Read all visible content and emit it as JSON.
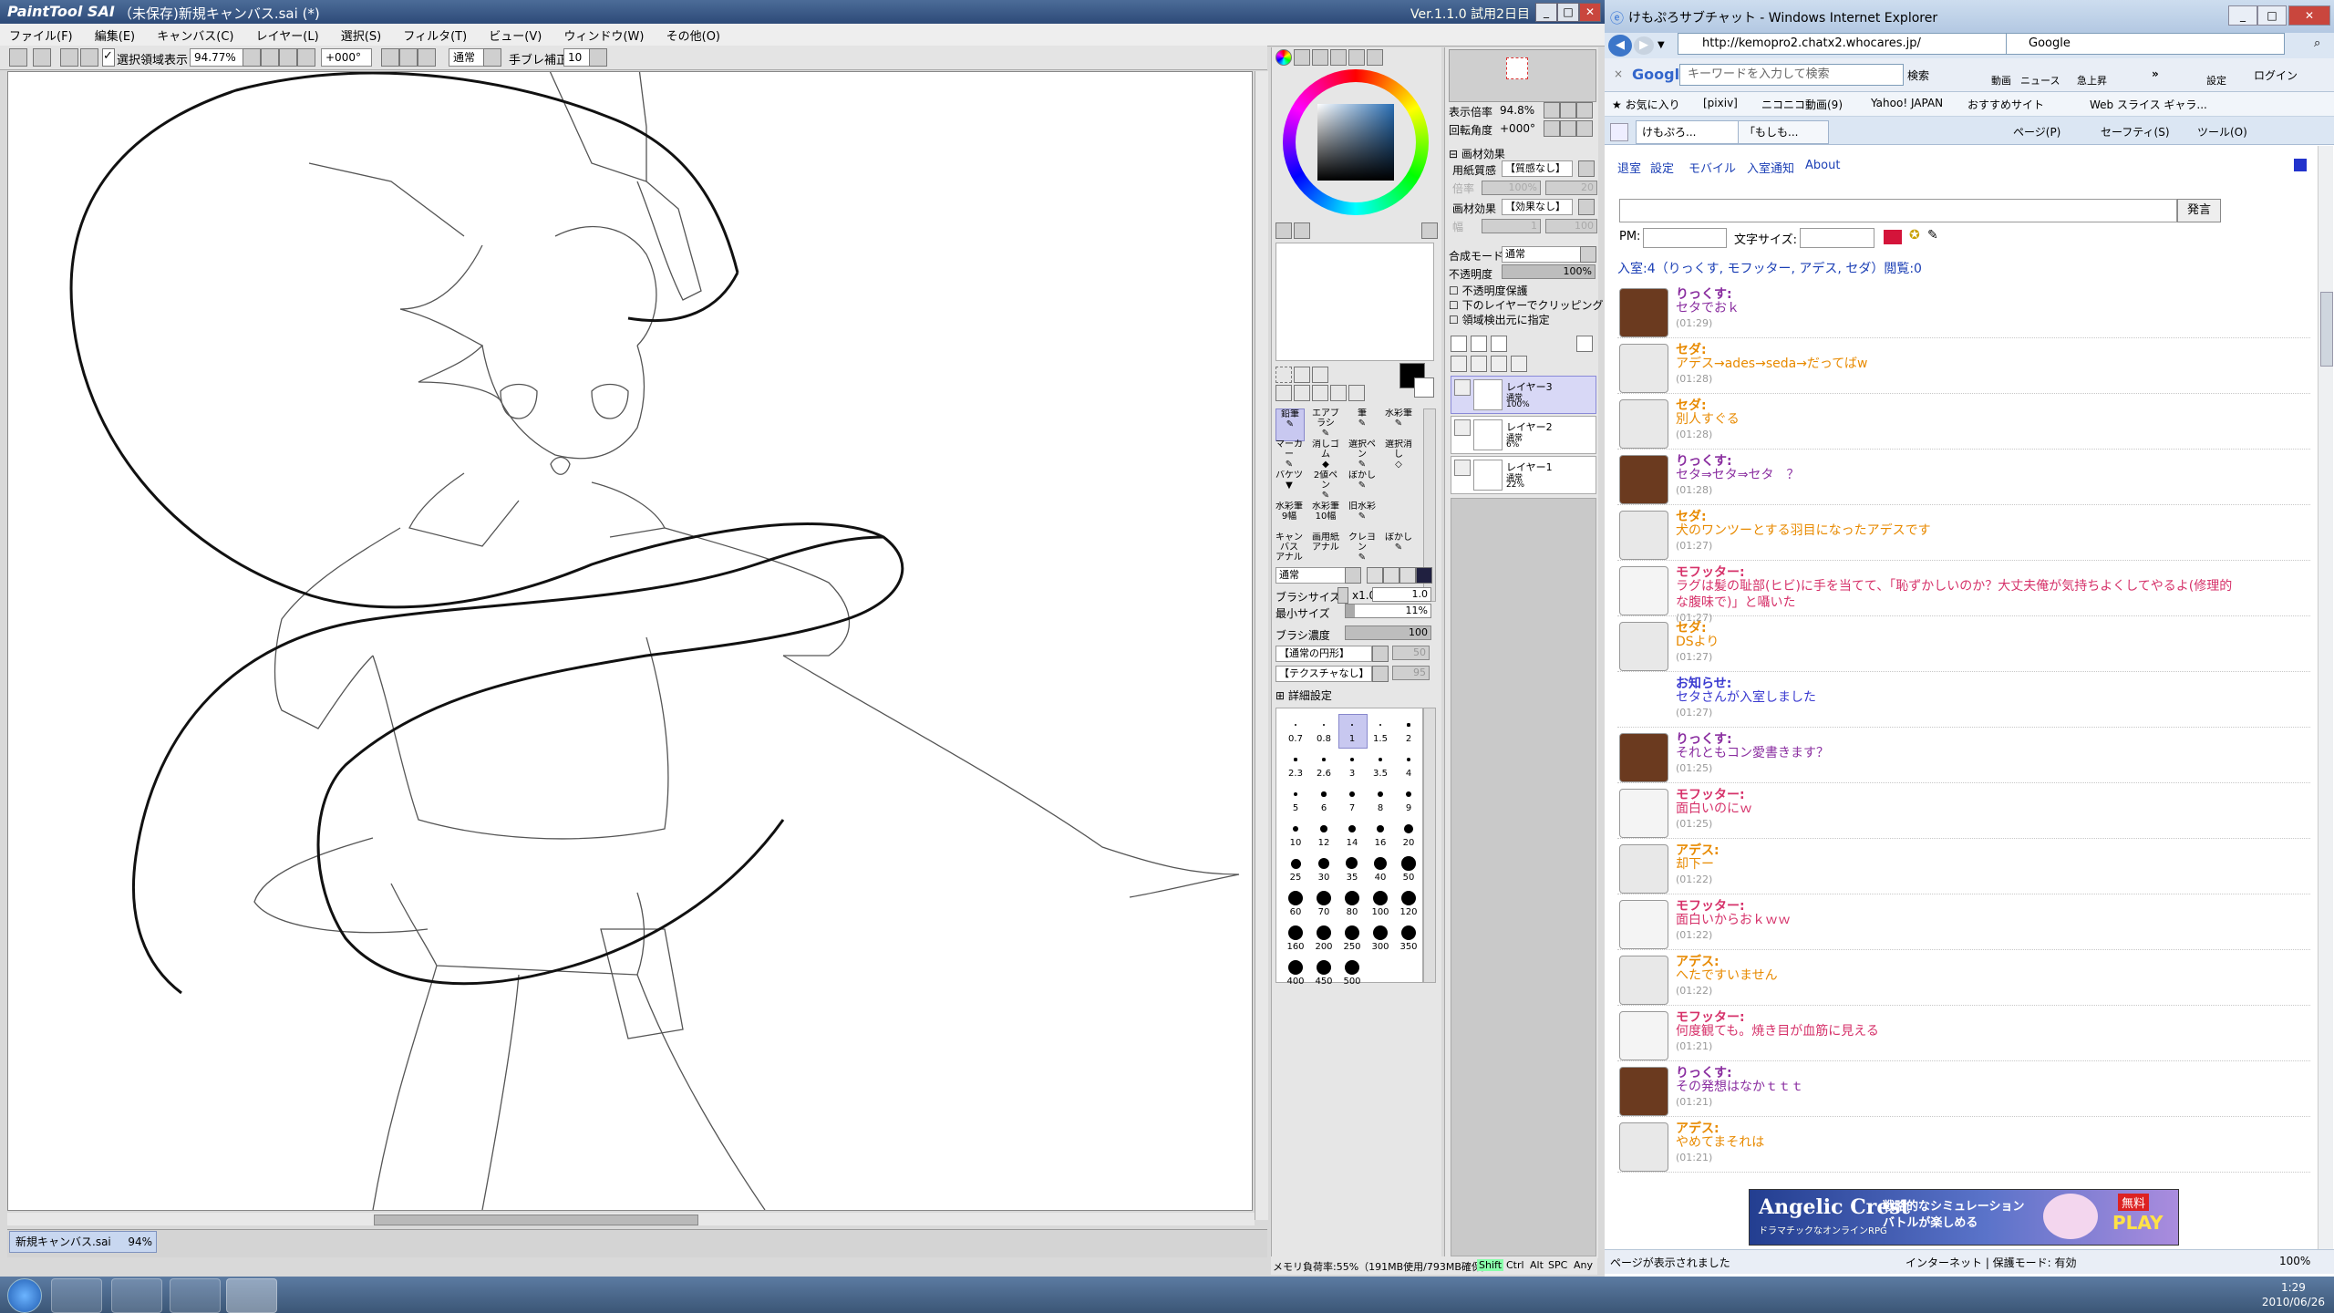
{
  "sai": {
    "logo": "PaintTool SAI",
    "title": "（未保存)新規キャンバス.sai (*)",
    "version": "Ver.1.1.0 試用2日目",
    "win_buttons": {
      "min": "_",
      "max": "□",
      "close": "✕"
    },
    "menu": [
      "ファイル(F)",
      "編集(E)",
      "キャンバス(C)",
      "レイヤー(L)",
      "選択(S)",
      "フィルタ(T)",
      "ビュー(V)",
      "ウィンドウ(W)",
      "その他(O)"
    ],
    "toolbar": {
      "show_selection_label": "選択領域表示",
      "zoom": "94.77%",
      "rotation": "+000°",
      "mode": "通常",
      "stabilizer_label": "手ブレ補正",
      "stabilizer_value": "10"
    },
    "nav_tab": {
      "name": "新規キャンバス.sai",
      "zoom": "94%"
    },
    "navigator": {
      "zoom_label": "表示倍率",
      "zoom_value": "94.8%",
      "angle_label": "回転角度",
      "angle_value": "+000°"
    },
    "paper": {
      "header": "画材効果",
      "texture_label": "用紙質感",
      "texture_value": "【質感なし】",
      "scale_label": "倍率",
      "scale_value": "100%",
      "strength_value": "20",
      "effect_label": "画材効果",
      "effect_value": "【効果なし】",
      "width_label": "幅",
      "width_value": "1",
      "effect_strength": "100"
    },
    "blend": {
      "label": "合成モード",
      "value": "通常"
    },
    "opacity": {
      "label": "不透明度",
      "value": "100%"
    },
    "checkboxes": [
      "不透明度保護",
      "下のレイヤーでクリッピング",
      "領域検出元に指定"
    ],
    "layers": [
      {
        "name": "レイヤー3",
        "mode": "通常",
        "opacity": "100%"
      },
      {
        "name": "レイヤー2",
        "mode": "通常",
        "opacity": "6%"
      },
      {
        "name": "レイヤー1",
        "mode": "通常",
        "opacity": "22%"
      }
    ],
    "tools": [
      [
        "鉛筆",
        "エアブラシ",
        "筆",
        "水彩筆"
      ],
      [
        "マーカー",
        "消しゴム",
        "選択ペン",
        "選択消し"
      ],
      [
        "バケツ",
        "2値ペン",
        "ぼかし",
        ""
      ],
      [
        "水彩筆",
        "水彩筆",
        "旧水彩",
        ""
      ],
      [
        "キャンバス",
        "画用紙",
        "クレヨン",
        "ぼかし"
      ]
    ],
    "tool_extra": [
      "9幅",
      "10幅",
      "アナル",
      "アナル"
    ],
    "brush": {
      "mode": "通常",
      "size_label": "ブラシサイズ",
      "size_mult": "x1.0",
      "size_value": "1.0",
      "min_label": "最小サイズ",
      "min_value": "11%",
      "density_label": "ブラシ濃度",
      "density_value": "100",
      "shape_value": "【通常の円形】",
      "shape_strength": "50",
      "texture_value": "【テクスチャなし】",
      "texture_strength": "95",
      "detail_label": "詳細設定"
    },
    "brush_sizes": [
      "0.7",
      "0.8",
      "1",
      "1.5",
      "2",
      "2.3",
      "2.6",
      "3",
      "3.5",
      "4",
      "5",
      "6",
      "7",
      "8",
      "9",
      "10",
      "12",
      "14",
      "16",
      "20",
      "25",
      "30",
      "35",
      "40",
      "50",
      "60",
      "70",
      "80",
      "100",
      "120",
      "160",
      "200",
      "250",
      "300",
      "350",
      "400",
      "450",
      "500"
    ],
    "status": {
      "memory": "メモリ負荷率:55%（191MB使用/793MB確保）",
      "keys": [
        "Shift",
        "Ctrl",
        "Alt",
        "SPC",
        "Any"
      ]
    }
  },
  "ie": {
    "title": "けもぷろサブチャット - Windows Internet Explorer",
    "url": "http://kemopro2.chatx2.whocares.jp/",
    "search_engine": "Google",
    "google_bar": {
      "brand": "Google",
      "placeholder": "キーワードを入力して検索",
      "search": "検索",
      "video": "動画",
      "news": "ニュース",
      "rising": "急上昇",
      "settings": "設定",
      "login": "ログイン"
    },
    "favorites": {
      "label": "お気に入り",
      "items": [
        "[pixiv]",
        "ニコニコ動画(9)",
        "Yahoo! JAPAN",
        "おすすめサイト",
        "Web スライス ギャラ..."
      ]
    },
    "tabs": [
      "けもぷろ...",
      "「もしも..."
    ],
    "commands": [
      "ページ(P)",
      "セーフティ(S)",
      "ツール(O)"
    ],
    "chat": {
      "links": [
        "退室",
        "設定",
        "モバイル",
        "入室通知",
        "About"
      ],
      "send_label": "発言",
      "pm_label": "PM:",
      "font_size_label": "文字サイズ:",
      "room_info": "入室:4（りっくす, モフッター, アデス, セダ）閲覧:0",
      "messages": [
        {
          "name": "りっくす:",
          "text": "セタでおｋ",
          "time": "(01:29)",
          "color": "#8a2ea0",
          "avatar": "brown"
        },
        {
          "name": "セダ:",
          "text": "アデス→ades→seda→だってばw",
          "time": "(01:28)",
          "color": "#e88a00",
          "avatar": "grey"
        },
        {
          "name": "セダ:",
          "text": "別人すぐる",
          "time": "(01:28)",
          "color": "#e88a00",
          "avatar": "grey"
        },
        {
          "name": "りっくす:",
          "text": "セタ⇒セタ⇒セタ　？",
          "time": "(01:28)",
          "color": "#8a2ea0",
          "avatar": "brown"
        },
        {
          "name": "セダ:",
          "text": "犬のワンツーとする羽目になったアデスです",
          "time": "(01:27)",
          "color": "#e88a00",
          "avatar": "grey"
        },
        {
          "name": "モフッター:",
          "text": "ラグは髪の耻部(ヒビ)に手を当てて、「恥ずかしいのか？大丈夫俺が気持ちよくしてやるよ(修理的な腹味で)」と囁いた",
          "time": "(01:27)",
          "color": "#d6326a",
          "avatar": "white"
        },
        {
          "name": "セダ:",
          "text": "DSより",
          "time": "(01:27)",
          "color": "#e88a00",
          "avatar": "grey"
        },
        {
          "name": "お知らせ:",
          "text": "セタさんが入室しました",
          "time": "(01:27)",
          "color": "#3a3ad0",
          "avatar": "none"
        },
        {
          "name": "りっくす:",
          "text": "それともコン愛書きます？",
          "time": "(01:25)",
          "color": "#8a2ea0",
          "avatar": "brown"
        },
        {
          "name": "モフッター:",
          "text": "面白いのにｗ",
          "time": "(01:25)",
          "color": "#d6326a",
          "avatar": "white"
        },
        {
          "name": "アデス:",
          "text": "却下ー",
          "time": "(01:22)",
          "color": "#e88a00",
          "avatar": "grey"
        },
        {
          "name": "モフッター:",
          "text": "面白いからおｋｗｗ",
          "time": "(01:22)",
          "color": "#d6326a",
          "avatar": "white"
        },
        {
          "name": "アデス:",
          "text": "へたですいません",
          "time": "(01:22)",
          "color": "#e88a00",
          "avatar": "grey"
        },
        {
          "name": "モフッター:",
          "text": "何度観ても。焼き目が血筋に見える",
          "time": "(01:21)",
          "color": "#d6326a",
          "avatar": "white"
        },
        {
          "name": "りっくす:",
          "text": "その発想はなかｔｔｔ",
          "time": "(01:21)",
          "color": "#8a2ea0",
          "avatar": "brown"
        },
        {
          "name": "アデス:",
          "text": "やめてまそれは",
          "time": "(01:21)",
          "color": "#e88a00",
          "avatar": "grey"
        }
      ]
    },
    "banner": {
      "title": "Angelic Crest",
      "sub": "ドラマチックなオンラインRPG",
      "tagline": "戦略的なシミュレーション バトルが楽しめる",
      "free": "無料",
      "play": "PLAY"
    },
    "status": {
      "left": "ページが表示されました",
      "zone": "インターネット | 保護モード: 有効",
      "zoom": "100%"
    }
  },
  "taskbar": {
    "time": "1:29",
    "date": "2010/06/26"
  }
}
